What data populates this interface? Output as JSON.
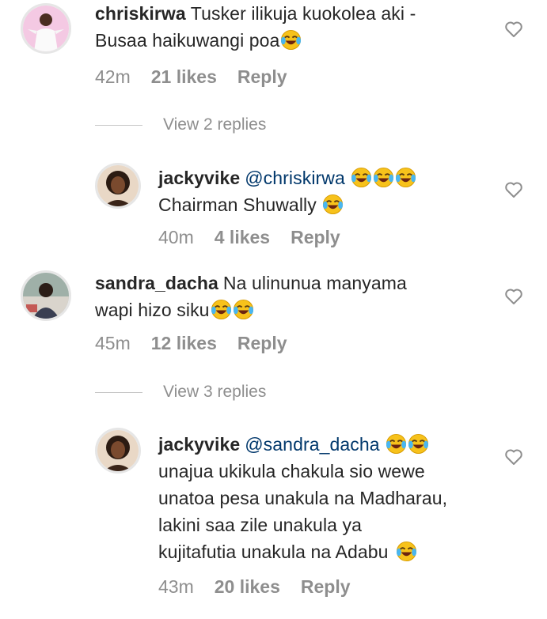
{
  "comments": [
    {
      "username": "chriskirwa",
      "text": "Tusker ilikuja kuokolea aki -",
      "text_line2": "Busaa haikuwangi poa",
      "time": "42m",
      "likes": "21 likes",
      "reply": "Reply",
      "view_replies": "View 2 replies"
    },
    {
      "username": "jackyvike",
      "mention": "@chriskirwa",
      "text_line2": "Chairman Shuwally",
      "time": "40m",
      "likes": "4 likes",
      "reply": "Reply"
    },
    {
      "username": "sandra_dacha",
      "text": "Na ulinunua manyama",
      "text_line2": "wapi hizo siku",
      "time": "45m",
      "likes": "12 likes",
      "reply": "Reply",
      "view_replies": "View 3 replies"
    },
    {
      "username": "jackyvike",
      "mention": "@sandra_dacha",
      "lines": [
        "unajua ukikula chakula sio wewe",
        "unatoa pesa unakula na Madharau,",
        "lakini saa zile unakula ya",
        "kujitafutia unakula na Adabu"
      ],
      "time": "43m",
      "likes": "20 likes",
      "reply": "Reply"
    }
  ],
  "icons": {
    "emoji": "face-with-tears-of-joy-icon",
    "like": "heart-outline-icon"
  },
  "colors": {
    "text": "#262626",
    "meta": "#8e8e8e",
    "mention": "#00376b"
  }
}
